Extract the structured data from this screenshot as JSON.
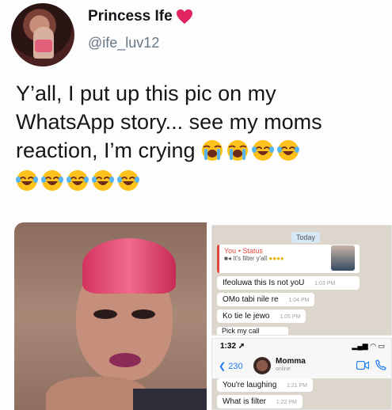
{
  "profile": {
    "display_name": "Princess Ife",
    "name_emoji": "heart-icon",
    "handle": "@ife_luv12"
  },
  "tweet": {
    "text": "Y’all, I put up this pic on my WhatsApp story... see my moms reaction, I’m crying",
    "emojis_line1": [
      "loudly-crying-face-icon",
      "loudly-crying-face-icon",
      "laughing-face-icon",
      "laughing-face-icon"
    ],
    "emojis_line2": [
      "laughing-face-icon",
      "laughing-face-icon",
      "laughing-face-icon",
      "laughing-face-icon",
      "laughing-face-icon"
    ]
  },
  "chat_screenshot_1": {
    "date_divider": "Today",
    "status_reply": {
      "from": "You • Status",
      "text": "It's filter y'all"
    },
    "messages": [
      {
        "text": "Ifeoluwa this Is not yoU",
        "time": "1:03 PM"
      },
      {
        "text": "OMo tabi nile re",
        "time": "1:04 PM"
      },
      {
        "text": "Ko tie le jewo",
        "time": "1:05 PM"
      }
    ],
    "partial_message": "Pick my call"
  },
  "chat_screenshot_2": {
    "status_time": "1:32",
    "back_label": "230",
    "contact_name": "Momma",
    "contact_status": "online",
    "messages": [
      {
        "text": "You're laughing",
        "time": "1:21 PM"
      },
      {
        "text": "What is filter",
        "time": "1:22 PM"
      }
    ]
  },
  "colors": {
    "text": "#14171a",
    "handle": "#657786",
    "heart": "#e0245e",
    "whatsapp_status_accent": "#e0463d",
    "ios_blue": "#1a7cf5"
  }
}
